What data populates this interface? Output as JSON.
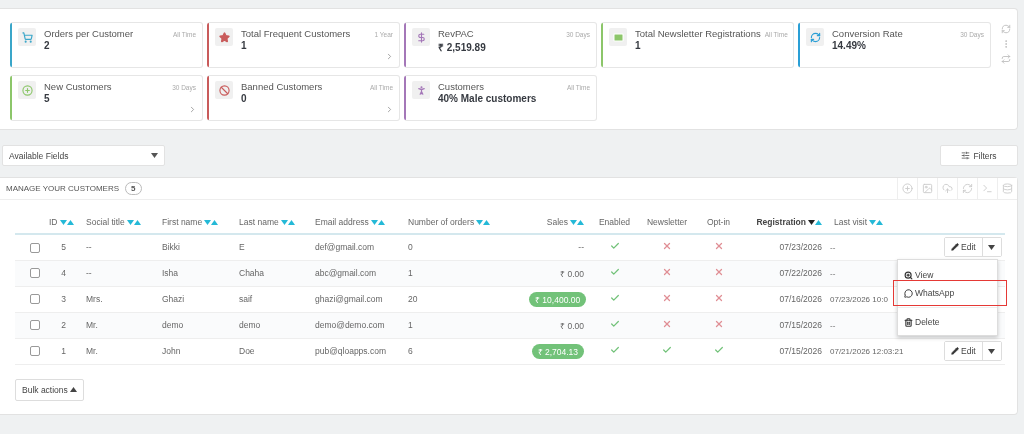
{
  "kpi_cards": [
    {
      "title": "Orders per Customer",
      "period": "All Time",
      "value": "2",
      "color": "#3aa6c9",
      "linked": false
    },
    {
      "title": "Total Frequent Customers",
      "period": "1 Year",
      "value": "1",
      "color": "#c95b5b",
      "linked": true
    },
    {
      "title": "RevPAC",
      "period": "30 Days",
      "value": "₹ 2,519.89",
      "color": "#a477b8",
      "linked": false
    },
    {
      "title": "Total Newsletter Registrations",
      "period": "All Time",
      "value": "1",
      "color": "#8cc66a",
      "linked": false
    },
    {
      "title": "Conversion Rate",
      "period": "30 Days",
      "value": "14.49%",
      "color": "#2a9fd6",
      "linked": false
    },
    {
      "title": "New Customers",
      "period": "30 Days",
      "value": "5",
      "color": "#8cc66a",
      "linked": true
    },
    {
      "title": "Banned Customers",
      "period": "All Time",
      "value": "0",
      "color": "#c95b5b",
      "linked": true
    },
    {
      "title": "Customers",
      "period": "All Time",
      "value": "40% Male customers",
      "color": "#a477b8",
      "linked": false
    }
  ],
  "fields_select": {
    "value": "Available Fields"
  },
  "filters_button": "Filters",
  "customers_panel": {
    "title": "MANAGE YOUR CUSTOMERS",
    "count": "5",
    "columns": [
      {
        "label": "ID",
        "kind": "sortable",
        "sorted": false
      },
      {
        "label": "Social title",
        "kind": "sortable",
        "sorted": false
      },
      {
        "label": "First name",
        "kind": "sortable",
        "sorted": false
      },
      {
        "label": "Last name",
        "kind": "sortable",
        "sorted": false
      },
      {
        "label": "Email address",
        "kind": "sortable",
        "sorted": false
      },
      {
        "label": "Number of orders",
        "kind": "sortable",
        "sorted": false
      },
      {
        "label": "Sales",
        "kind": "sortable",
        "sorted": false
      },
      {
        "label": "Enabled",
        "kind": "plain"
      },
      {
        "label": "Newsletter",
        "kind": "plain"
      },
      {
        "label": "Opt-in",
        "kind": "plain"
      },
      {
        "label": "Registration",
        "kind": "sortable",
        "sorted": true
      },
      {
        "label": "Last visit",
        "kind": "sortable",
        "sorted": false
      }
    ],
    "rows": [
      {
        "checked": false,
        "id": "5",
        "social_title": "--",
        "first_name": "Bikki",
        "last_name": "E",
        "email": "def@gmail.com",
        "orders": "0",
        "sales": {
          "text": "--",
          "kind": "plain"
        },
        "enabled": true,
        "newsletter": false,
        "opt_in": false,
        "registration": "07/23/2026",
        "last_visit": "--",
        "edit_button": "Edit"
      },
      {
        "checked": false,
        "id": "4",
        "social_title": "--",
        "first_name": "Isha",
        "last_name": "Chaha",
        "email": "abc@gmail.com",
        "orders": "1",
        "sales": {
          "text": "₹ 0.00",
          "kind": "plain"
        },
        "enabled": true,
        "newsletter": false,
        "opt_in": false,
        "registration": "07/22/2026",
        "last_visit": "--"
      },
      {
        "checked": false,
        "id": "3",
        "social_title": "Mrs.",
        "first_name": "Ghazi",
        "last_name": "saif",
        "email": "ghazi@gmail.com",
        "orders": "20",
        "sales": {
          "text": "₹ 10,400.00",
          "kind": "badge"
        },
        "enabled": true,
        "newsletter": false,
        "opt_in": false,
        "registration": "07/16/2026",
        "last_visit": "07/23/2026 10:0"
      },
      {
        "checked": false,
        "id": "2",
        "social_title": "Mr.",
        "first_name": "demo",
        "last_name": "demo",
        "email": "demo@demo.com",
        "orders": "1",
        "sales": {
          "text": "₹ 0.00",
          "kind": "plain"
        },
        "enabled": true,
        "newsletter": false,
        "opt_in": false,
        "registration": "07/15/2026",
        "last_visit": "--"
      },
      {
        "checked": false,
        "id": "1",
        "social_title": "Mr.",
        "first_name": "John",
        "last_name": "Doe",
        "email": "pub@qloapps.com",
        "orders": "6",
        "sales": {
          "text": "₹ 2,704.13",
          "kind": "badge"
        },
        "enabled": true,
        "newsletter": true,
        "opt_in": true,
        "registration": "07/15/2026",
        "last_visit": "07/21/2026 12:03:21",
        "edit_button": "Edit"
      }
    ],
    "action_menu": {
      "items": [
        {
          "label": "View",
          "kind": "view",
          "highlighted": false
        },
        {
          "label": "WhatsApp",
          "kind": "whatsapp",
          "highlighted": true
        },
        {
          "label": "Delete",
          "kind": "delete",
          "highlighted": false
        }
      ]
    },
    "bulk_actions": "Bulk actions"
  }
}
